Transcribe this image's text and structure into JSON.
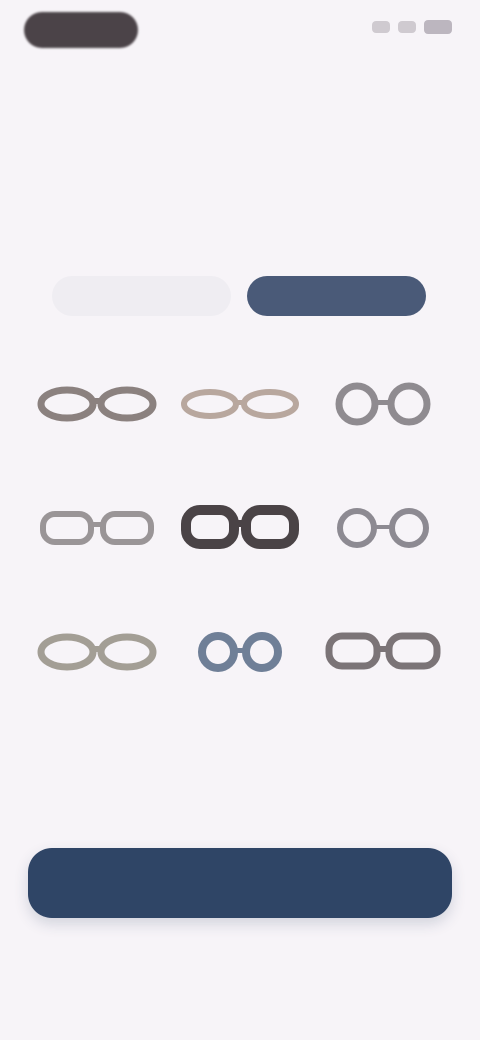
{
  "colors": {
    "background": "#f7f4f8",
    "accent": "#4a5a78",
    "primary": "#2f4566"
  },
  "status_bar": {
    "icons": [
      "signal-icon",
      "wifi-icon",
      "battery-icon"
    ]
  },
  "header": {
    "title": ""
  },
  "question": {
    "text": ""
  },
  "segmented": {
    "options": [
      {
        "label": "",
        "selected": false
      },
      {
        "label": "",
        "selected": true
      }
    ]
  },
  "frames": [
    {
      "label": "",
      "color": "#8b817f"
    },
    {
      "label": "",
      "color": "#b8a79e"
    },
    {
      "label": "",
      "color": "#8f8b90"
    },
    {
      "label": "",
      "color": "#9a9597"
    },
    {
      "label": "",
      "color": "#4a4346"
    },
    {
      "label": "",
      "color": "#8d8a92"
    },
    {
      "label": "",
      "color": "#a39e95"
    },
    {
      "label": "",
      "color": "#6f7f97"
    },
    {
      "label": "",
      "color": "#7b7477"
    }
  ],
  "primary_action": {
    "label": ""
  },
  "footer": {
    "link": ""
  }
}
